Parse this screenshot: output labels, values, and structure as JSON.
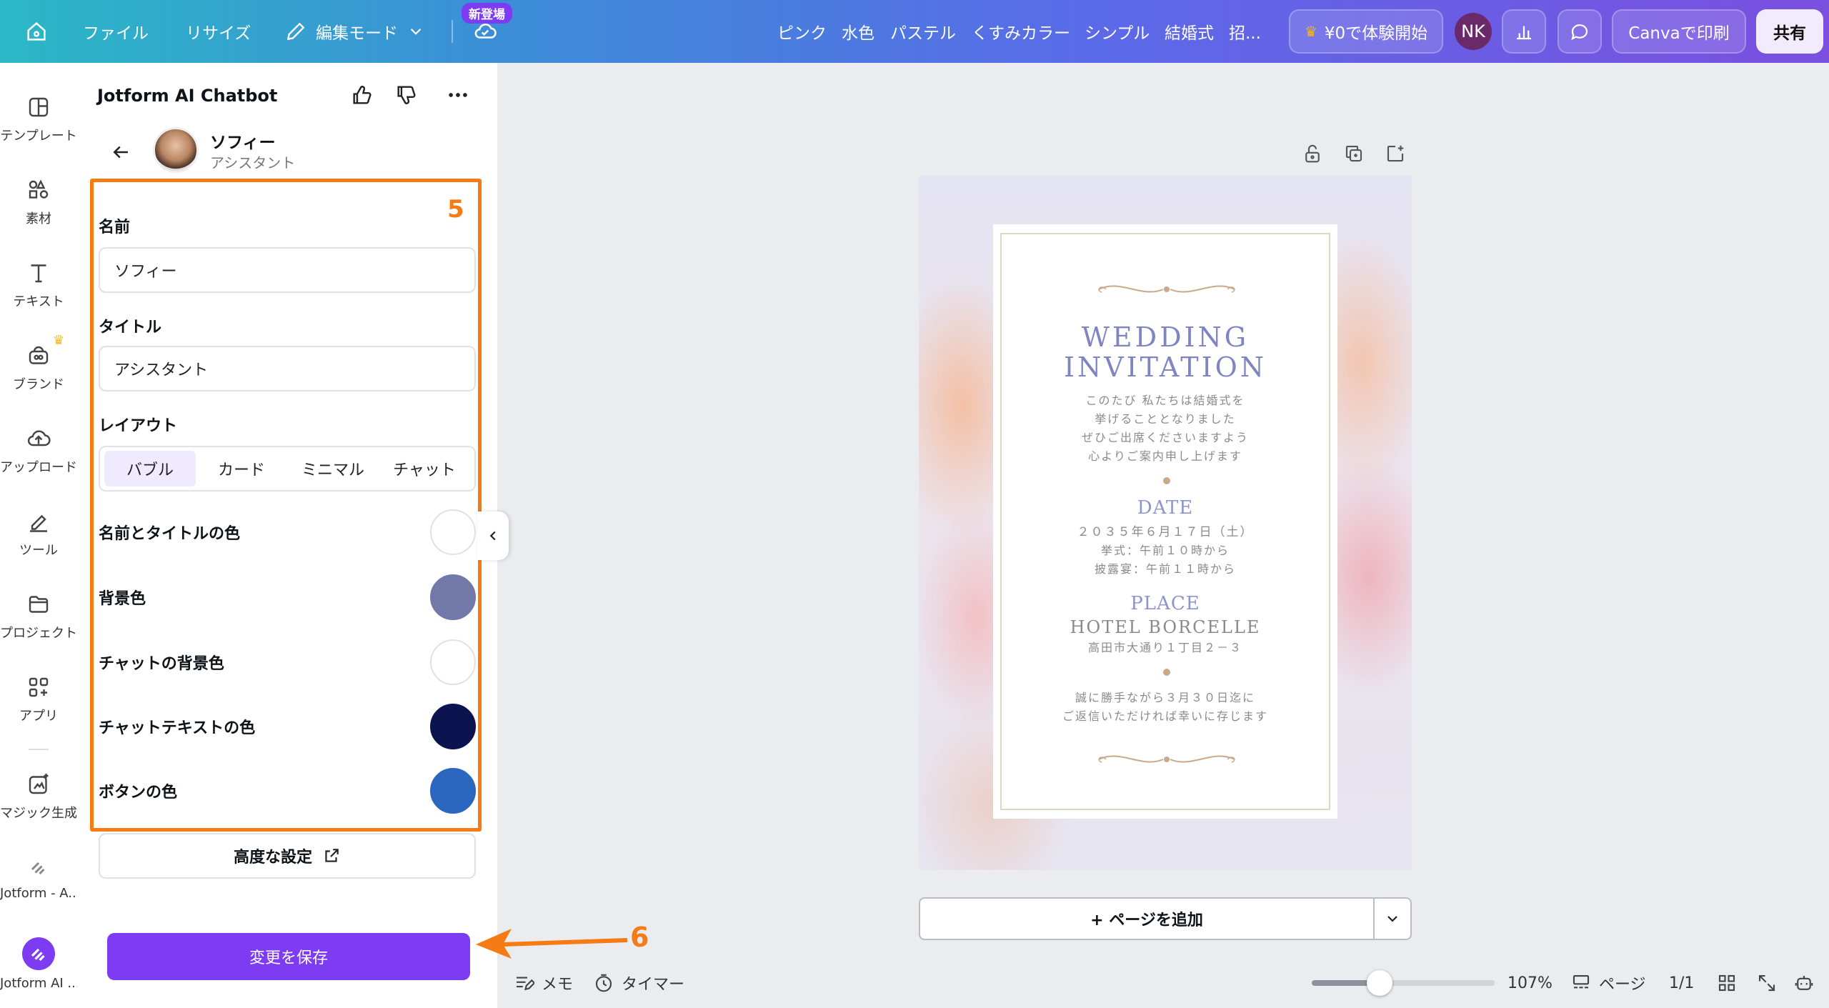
{
  "topbar": {
    "file": "ファイル",
    "resize": "リサイズ",
    "edit_mode": "編集モード",
    "new_badge": "新登場",
    "tags": [
      "ピンク",
      "水色",
      "パステル",
      "くすみカラー",
      "シンプル",
      "結婚式",
      "招..."
    ],
    "trial": "¥0で体験開始",
    "avatar_initials": "NK",
    "print": "Canvaで印刷",
    "share": "共有"
  },
  "rail": [
    {
      "label": "テンプレート",
      "icon": "template-icon"
    },
    {
      "label": "素材",
      "icon": "elements-icon"
    },
    {
      "label": "テキスト",
      "icon": "text-icon"
    },
    {
      "label": "ブランド",
      "icon": "brand-icon"
    },
    {
      "label": "アップロード",
      "icon": "upload-icon"
    },
    {
      "label": "ツール",
      "icon": "tools-icon"
    },
    {
      "label": "プロジェクト",
      "icon": "folder-icon"
    },
    {
      "label": "アプリ",
      "icon": "apps-icon"
    },
    {
      "label": "マジック生成",
      "icon": "magic-icon"
    },
    {
      "label": "Jotform - A...",
      "icon": "jotform-icon"
    },
    {
      "label": "Jotform AI ...",
      "icon": "jotform-ai-icon"
    }
  ],
  "panel": {
    "title": "Jotform AI Chatbot",
    "bot_name": "ソフィー",
    "bot_role": "アシスタント",
    "step_number": "5",
    "name_label": "名前",
    "name_value": "ソフィー",
    "title_label": "タイトル",
    "title_value": "アシスタント",
    "layout_label": "レイアウト",
    "layout_options": [
      "バブル",
      "カード",
      "ミニマル",
      "チャット"
    ],
    "layout_selected": "バブル",
    "colors": [
      {
        "label": "名前とタイトルの色",
        "color": "#ffffff"
      },
      {
        "label": "背景色",
        "color": "#7278a8"
      },
      {
        "label": "チャットの背景色",
        "color": "#ffffff"
      },
      {
        "label": "チャットテキストの色",
        "color": "#0c1450"
      },
      {
        "label": "ボタンの色",
        "color": "#2b66bf"
      }
    ],
    "advanced": "高度な設定",
    "save": "変更を保存",
    "step6": "6"
  },
  "invitation": {
    "title_line1": "WEDDING",
    "title_line2": "INVITATION",
    "intro": [
      "このたび 私たちは結婚式を",
      "挙げることとなりました",
      "ぜひご出席くださいますよう",
      "心よりご案内申し上げます"
    ],
    "date_head": "DATE",
    "date_lines": [
      "２０３５年６月１７日（土）",
      "挙式：午前１０時から",
      "披露宴：午前１１時から"
    ],
    "place_head": "PLACE",
    "hotel": "HOTEL BORCELLE",
    "address": "高田市大通り１丁目２－３",
    "rsvp": [
      "誠に勝手ながら３月３０日迄に",
      "ご返信いただければ幸いに存じます"
    ]
  },
  "canvas": {
    "add_page": "+ ページを追加"
  },
  "bottombar": {
    "memo": "メモ",
    "timer": "タイマー",
    "zoom": "107%",
    "zoom_fraction": 0.37,
    "pages_label": "ページ",
    "page_count": "1/1"
  }
}
